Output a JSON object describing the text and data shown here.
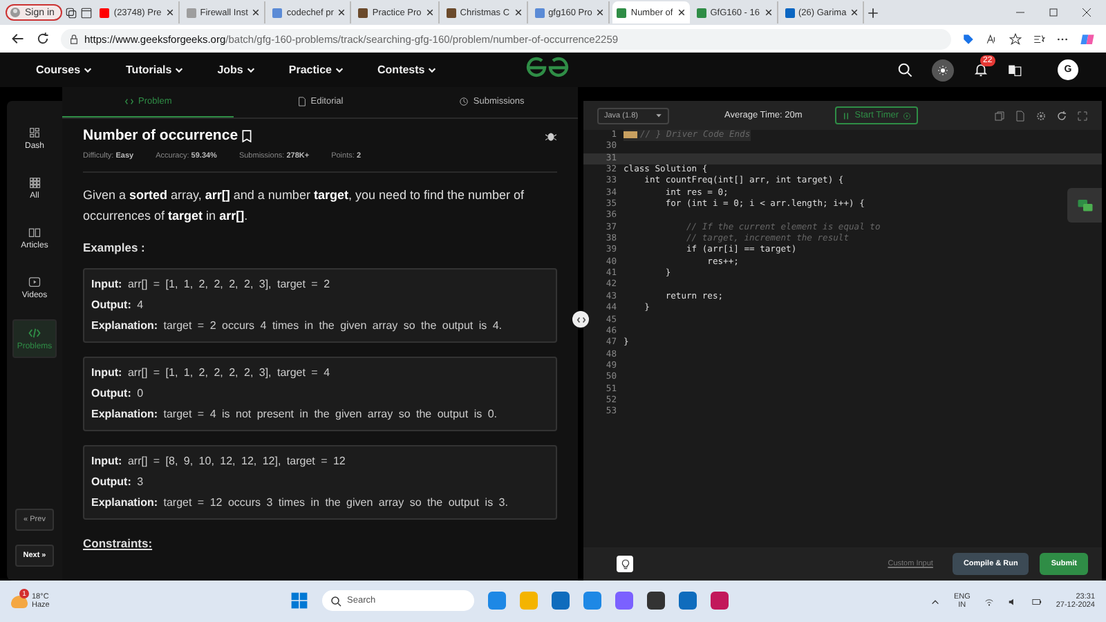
{
  "browser": {
    "profile": "Sign in",
    "tabs": [
      {
        "title": "(23748) Pre",
        "selected": false
      },
      {
        "title": "Firewall Inst",
        "selected": false
      },
      {
        "title": "codechef pr",
        "selected": false
      },
      {
        "title": "Practice Pro",
        "selected": false
      },
      {
        "title": "Christmas C",
        "selected": false
      },
      {
        "title": "gfg160 Pro",
        "selected": false
      },
      {
        "title": "Number of",
        "selected": true
      },
      {
        "title": "GfG160 - 16",
        "selected": false
      },
      {
        "title": "(26) Garima",
        "selected": false
      }
    ],
    "url_host": "https://www.geeksforgeeks.org",
    "url_path": "/batch/gfg-160-problems/track/searching-gfg-160/problem/number-of-occurrence2259"
  },
  "nav": {
    "menu": [
      "Courses",
      "Tutorials",
      "Jobs",
      "Practice",
      "Contests"
    ],
    "notifications": "22",
    "avatar": "G"
  },
  "sidebar": {
    "items": [
      {
        "label": "Dash",
        "selected": false
      },
      {
        "label": "All",
        "selected": false
      },
      {
        "label": "Articles",
        "selected": false
      },
      {
        "label": "Videos",
        "selected": false
      },
      {
        "label": "Problems",
        "selected": true
      }
    ],
    "prev": "« Prev",
    "next": "Next »"
  },
  "problem": {
    "tabs": [
      {
        "label": "Problem",
        "selected": true
      },
      {
        "label": "Editorial",
        "selected": false
      },
      {
        "label": "Submissions",
        "selected": false
      }
    ],
    "title": "Number of occurrence",
    "meta": [
      {
        "label": "Difficulty:",
        "value": "Easy"
      },
      {
        "label": "Accuracy:",
        "value": "59.34%"
      },
      {
        "label": "Submissions:",
        "value": "278K+"
      },
      {
        "label": "Points:",
        "value": "2"
      }
    ],
    "description": "Given a **sorted** array, **arr[]** and a number **target**, you need to find the number of occurrences of **target** in **arr[]**.",
    "examples_heading": "Examples :",
    "examples": [
      [
        {
          "label": "Input:",
          "text": "arr[] = [1, 1, 2, 2, 2, 2, 3], target = 2"
        },
        {
          "label": "Output:",
          "text": "4"
        },
        {
          "label": "Explanation:",
          "text": "target = 2 occurs 4 times in the given array so the output is 4."
        }
      ],
      [
        {
          "label": "Input:",
          "text": "arr[] = [1, 1, 2, 2, 2, 2, 3], target = 4"
        },
        {
          "label": "Output:",
          "text": "0"
        },
        {
          "label": "Explanation:",
          "text": "target = 4 is not present in the given array so the output is 0."
        }
      ],
      [
        {
          "label": "Input:",
          "text": "arr[] = [8, 9, 10, 12, 12, 12], target = 12"
        },
        {
          "label": "Output:",
          "text": "3"
        },
        {
          "label": "Explanation:",
          "text": "target = 12 occurs 3 times in the given array so the output is 3."
        }
      ]
    ],
    "constraints_heading": "Constraints:"
  },
  "editor": {
    "language": "Java (1.8)",
    "average_time": "Average Time: 20m",
    "timer": "Start Timer",
    "lines": [
      {
        "num": "1",
        "kind": "folded",
        "current": false,
        "code": "// } Driver Code Ends"
      },
      {
        "num": "30",
        "kind": "code",
        "current": false
      },
      {
        "num": "31",
        "kind": "code",
        "current": true
      },
      {
        "num": "32",
        "kind": "code",
        "current": false,
        "code": "class Solution {"
      },
      {
        "num": "33",
        "kind": "code",
        "current": false,
        "code": "    int countFreq(int[] arr, int target) {"
      },
      {
        "num": "34",
        "kind": "code",
        "current": false,
        "code": "        int res = 0;"
      },
      {
        "num": "35",
        "kind": "code",
        "current": false,
        "code": "        for (int i = 0; i < arr.length; i++) {"
      },
      {
        "num": "36",
        "kind": "code",
        "current": false
      },
      {
        "num": "37",
        "kind": "comment",
        "current": false,
        "code": "            // If the current element is equal to"
      },
      {
        "num": "38",
        "kind": "comment",
        "current": false,
        "code": "            // target, increment the result"
      },
      {
        "num": "39",
        "kind": "code",
        "current": false,
        "code": "            if (arr[i] == target)"
      },
      {
        "num": "40",
        "kind": "code",
        "current": false,
        "code": "                res++;"
      },
      {
        "num": "41",
        "kind": "code",
        "current": false,
        "code": "        }"
      },
      {
        "num": "42",
        "kind": "code",
        "current": false
      },
      {
        "num": "43",
        "kind": "code",
        "current": false,
        "code": "        return res;"
      },
      {
        "num": "44",
        "kind": "code",
        "current": false,
        "code": "    }"
      },
      {
        "num": "45",
        "kind": "code",
        "current": false
      },
      {
        "num": "46",
        "kind": "code",
        "current": false
      },
      {
        "num": "47",
        "kind": "code",
        "current": false,
        "code": "}"
      },
      {
        "num": "48",
        "kind": "code",
        "current": false
      },
      {
        "num": "49",
        "kind": "code",
        "current": false
      },
      {
        "num": "50",
        "kind": "code",
        "current": false
      },
      {
        "num": "51",
        "kind": "code",
        "current": false
      },
      {
        "num": "52",
        "kind": "code",
        "current": false
      },
      {
        "num": "53",
        "kind": "code",
        "current": false
      }
    ],
    "custom_input": "Custom Input",
    "compile": "Compile & Run",
    "submit": "Submit"
  },
  "taskbar": {
    "temperature": "18°C",
    "weather": "Haze",
    "weather_badge": "1",
    "search": "Search",
    "lang": "ENG",
    "region": "IN",
    "time": "23:31",
    "date": "27-12-2024"
  }
}
